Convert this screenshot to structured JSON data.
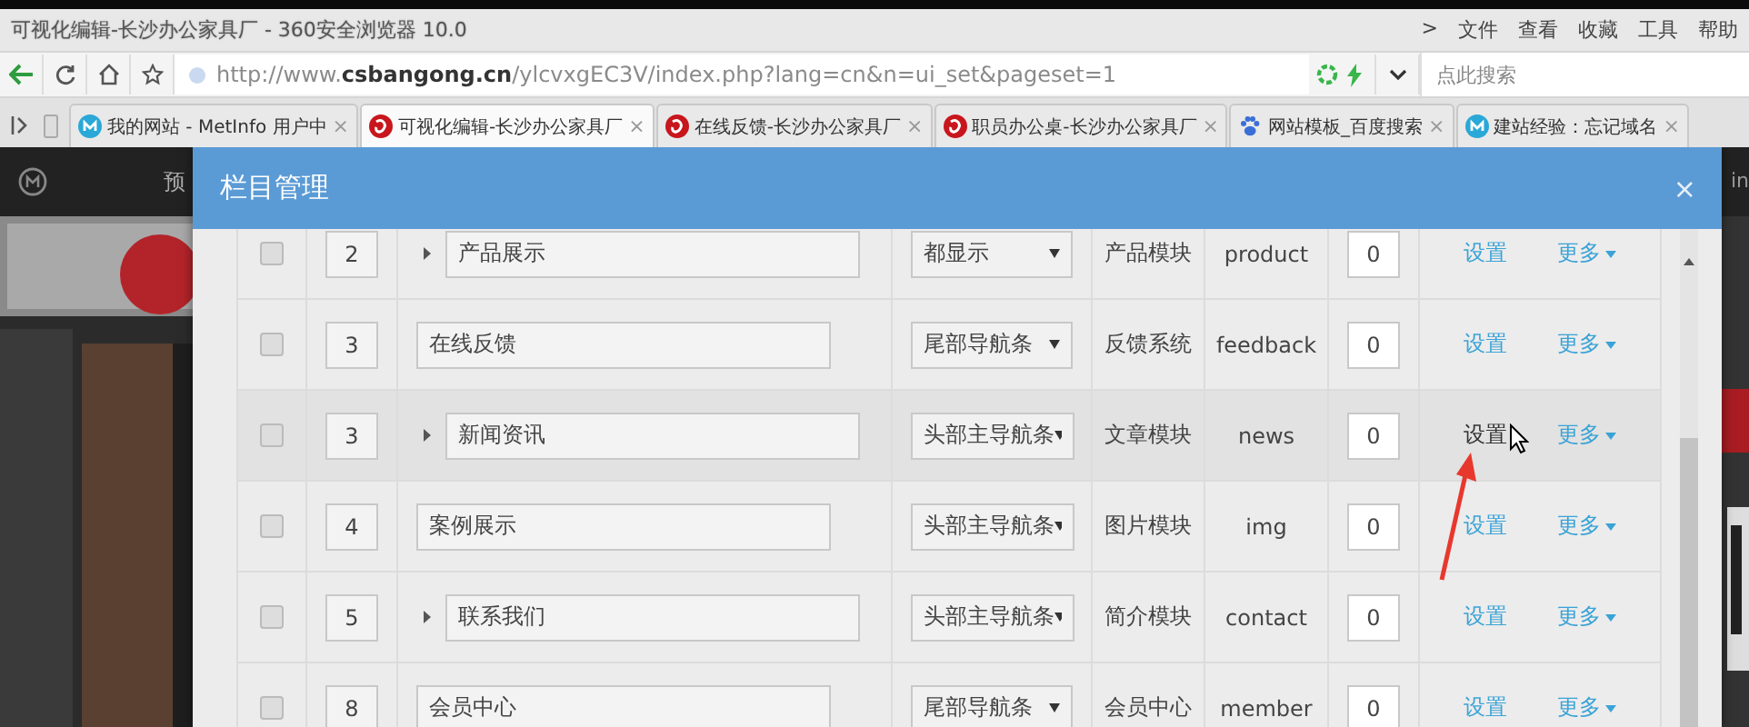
{
  "window": {
    "title": "可视化编辑-长沙办公家具厂 - 360安全浏览器 10.0",
    "menu": [
      ">",
      "文件",
      "查看",
      "收藏",
      "工具",
      "帮助"
    ]
  },
  "address_bar": {
    "url": "http://www.**csbangong.cn**/ylcvxgEC3V/index.php?lang=cn&n=ui_set&pageset=1",
    "search_placeholder": "点此搜索"
  },
  "tabs": [
    {
      "label": "我的网站 - MetInfo 用户中",
      "close": "×",
      "selected": false
    },
    {
      "label": "可视化编辑-长沙办公家具厂",
      "close": "×",
      "selected": true
    },
    {
      "label": "在线反馈-长沙办公家具厂",
      "close": "×",
      "selected": false
    },
    {
      "label": "职员办公桌-长沙办公家具厂",
      "close": "×",
      "selected": false
    },
    {
      "label": "网站模板_百度搜索",
      "close": "×",
      "selected": false
    },
    {
      "label": "建站经验：忘记域名",
      "close": "×",
      "selected": false
    }
  ],
  "page": {
    "nav_label": "预",
    "right_fragment": "in"
  },
  "modal": {
    "title": "栏目管理",
    "close": "×",
    "rows": [
      {
        "checked": false,
        "sort": "2",
        "name": "产品展示",
        "expandable": true,
        "nav": "都显示",
        "module": "产品模块",
        "folder": "product",
        "count": "0",
        "action": "设置",
        "more": "更多",
        "hovered": false
      },
      {
        "checked": false,
        "sort": "3",
        "name": "在线反馈",
        "expandable": false,
        "nav": "尾部导航条",
        "module": "反馈系统",
        "folder": "feedback",
        "count": "0",
        "action": "设置",
        "more": "更多",
        "hovered": false
      },
      {
        "checked": false,
        "sort": "3",
        "name": "新闻资讯",
        "expandable": true,
        "nav": "头部主导航条",
        "module": "文章模块",
        "folder": "news",
        "count": "0",
        "action": "设置",
        "more": "更多",
        "hovered": true
      },
      {
        "checked": false,
        "sort": "4",
        "name": "案例展示",
        "expandable": false,
        "nav": "头部主导航条",
        "module": "图片模块",
        "folder": "img",
        "count": "0",
        "action": "设置",
        "more": "更多",
        "hovered": false
      },
      {
        "checked": false,
        "sort": "5",
        "name": "联系我们",
        "expandable": true,
        "nav": "头部主导航条",
        "module": "简介模块",
        "folder": "contact",
        "count": "0",
        "action": "设置",
        "more": "更多",
        "hovered": false
      },
      {
        "checked": false,
        "sort": "8",
        "name": "会员中心",
        "expandable": false,
        "nav": "尾部导航条",
        "module": "会员中心",
        "folder": "member",
        "count": "0",
        "action": "设置",
        "more": "更多",
        "hovered": false
      }
    ]
  }
}
